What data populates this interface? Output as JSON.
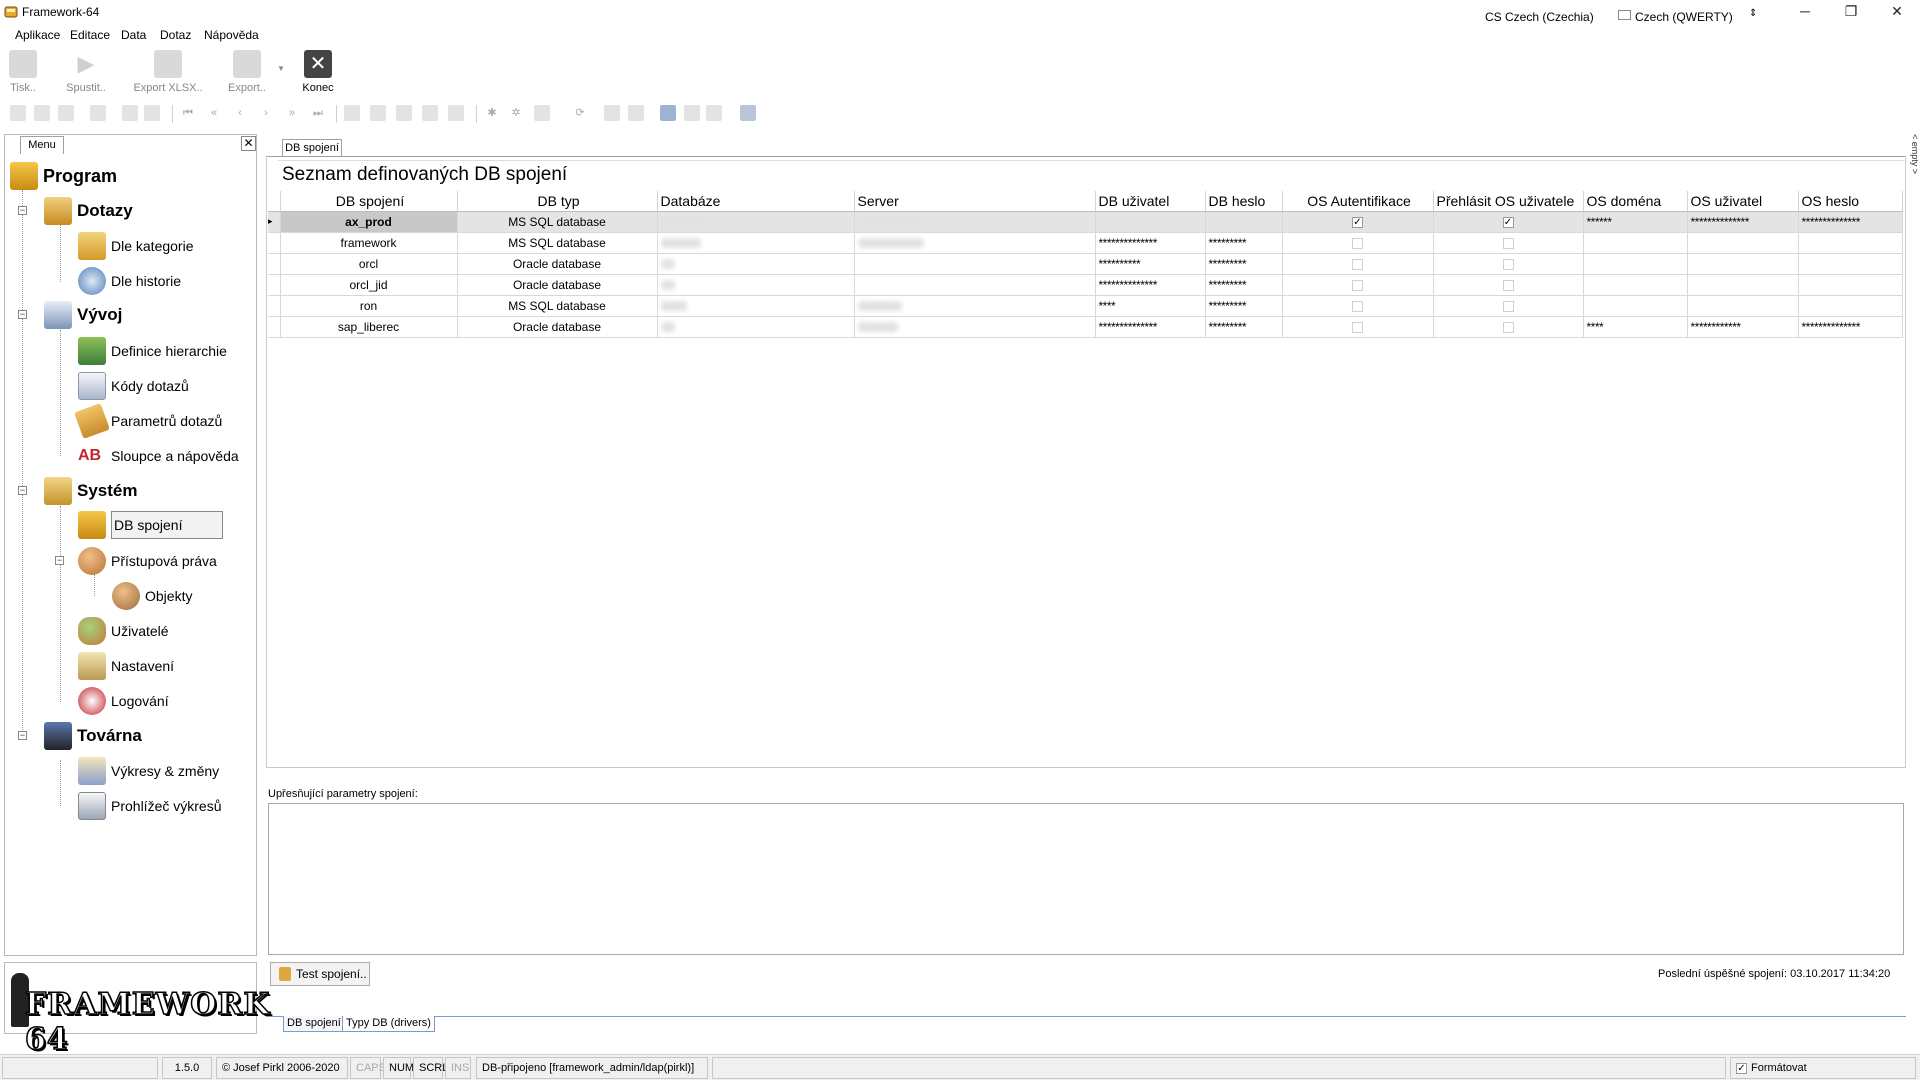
{
  "window": {
    "title": "Framework-64",
    "input_language": "CS Czech (Czechia)",
    "keyboard_layout": "Czech (QWERTY)",
    "minimize": "─",
    "restore": "❐",
    "close": "✕"
  },
  "menubar": [
    "Aplikace",
    "Editace",
    "Data",
    "Dotaz",
    "Nápověda"
  ],
  "toolbar": {
    "print": "Tisk..",
    "run": "Spustit..",
    "export_xlsx": "Export XLSX..",
    "export": "Export..",
    "quit": "Konec"
  },
  "menu_panel": {
    "tab": "Menu",
    "close": "✕",
    "program": "Program",
    "dotazy": "Dotazy",
    "dle_kategorie": "Dle kategorie",
    "dle_historie": "Dle historie",
    "vyvoj": "Vývoj",
    "definice_hierarchie": "Definice hierarchie",
    "kody_dotazu": "Kódy dotazů",
    "parametry_dotazu": "Parametrů dotazů",
    "sloupce_napoveda": "Sloupce a nápověda",
    "system": "Systém",
    "db_spojeni": "DB spojení",
    "pristupova_prava": "Přístupová práva",
    "objekty": "Objekty",
    "uzivatele": "Uživatelé",
    "nastaveni": "Nastavení",
    "logovani": "Logování",
    "tovarna": "Továrna",
    "vykresy_zmeny": "Výkresy & změny",
    "prohlizec_vykresu": "Prohlížeč výkresů"
  },
  "logo": "FRAMEWORK 64",
  "main": {
    "doc_tab": "DB spojení",
    "right_strip": "< empty >",
    "grid_title": "Seznam definovaných DB spojení",
    "columns": [
      "DB spojení",
      "DB typ",
      "Databáze",
      "Server",
      "DB uživatel",
      "DB heslo",
      "OS Autentifikace",
      "Přehlásit OS uživatele",
      "OS doména",
      "OS uživatel",
      "OS heslo"
    ],
    "rows": [
      {
        "name": "ax_prod",
        "type": "MS SQL database",
        "db_user": "",
        "db_pass": "",
        "os_auth": true,
        "os_relogin": true,
        "os_domain": "******",
        "os_user": "**************",
        "os_pass": "**************"
      },
      {
        "name": "framework",
        "type": "MS SQL database",
        "db_user": "**************",
        "db_pass": "*********",
        "os_auth": false,
        "os_relogin": false,
        "os_domain": "",
        "os_user": "",
        "os_pass": ""
      },
      {
        "name": "orcl",
        "type": "Oracle database",
        "db_user": "**********",
        "db_pass": "*********",
        "os_auth": false,
        "os_relogin": false,
        "os_domain": "",
        "os_user": "",
        "os_pass": ""
      },
      {
        "name": "orcl_jid",
        "type": "Oracle database",
        "db_user": "**************",
        "db_pass": "*********",
        "os_auth": false,
        "os_relogin": false,
        "os_domain": "",
        "os_user": "",
        "os_pass": ""
      },
      {
        "name": "ron",
        "type": "MS SQL database",
        "db_user": "****",
        "db_pass": "*********",
        "os_auth": false,
        "os_relogin": false,
        "os_domain": "",
        "os_user": "",
        "os_pass": ""
      },
      {
        "name": "sap_liberec",
        "type": "Oracle database",
        "db_user": "**************",
        "db_pass": "*********",
        "os_auth": false,
        "os_relogin": false,
        "os_domain": "****",
        "os_user": "************",
        "os_pass": "**************"
      }
    ],
    "params_label": "Upřesňující parametry spojení:",
    "test_button": "Test spojení..",
    "last_connection": "Poslední úspěšné spojení:  03.10.2017 11:34:20",
    "bottom_tabs": [
      "DB spojení",
      "Typy DB (drivers)"
    ]
  },
  "statusbar": {
    "version": "1.5.0",
    "copyright": "© Josef Pirkl 2006-2020",
    "caps": "CAPS",
    "num": "NUM",
    "scrl": "SCRL",
    "ins": "INS",
    "connection": "DB-připojeno [framework_admin/ldap(pirkl)]",
    "format": "Formátovat"
  },
  "colors": {
    "selected_row": "#e4e4e4",
    "selected_cell": "#c8c8c8",
    "tab_border": "#7a9cc8"
  }
}
